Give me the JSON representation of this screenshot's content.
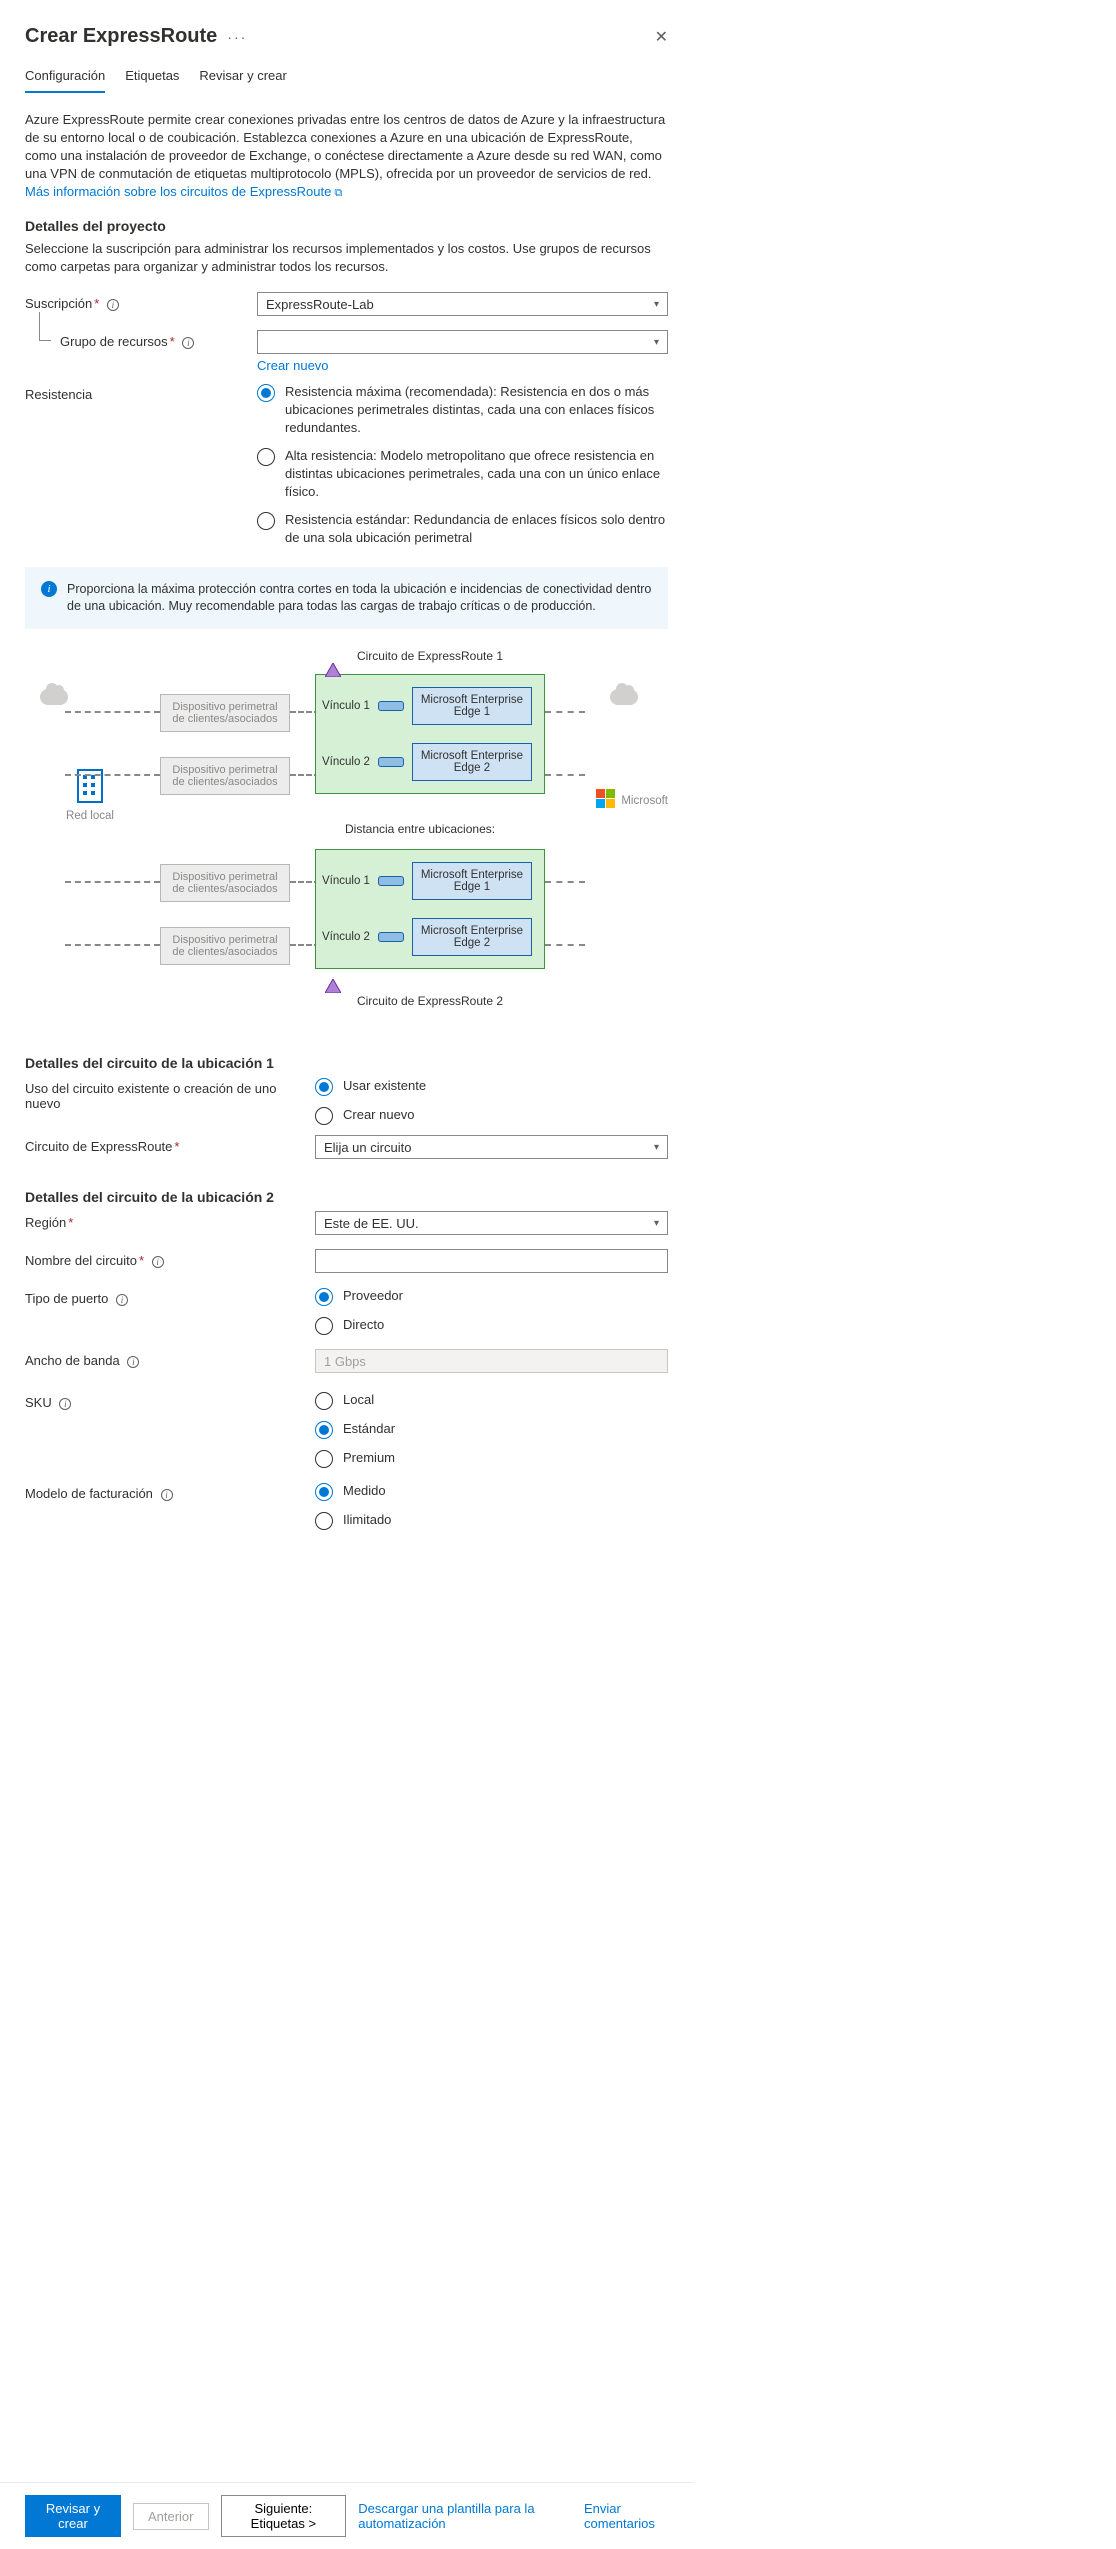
{
  "header": {
    "title": "Crear ExpressRoute",
    "more": "···",
    "close": "✕"
  },
  "tabs": [
    {
      "label": "Configuración",
      "active": true
    },
    {
      "label": "Etiquetas",
      "active": false
    },
    {
      "label": "Revisar y crear",
      "active": false
    }
  ],
  "intro": {
    "text": "Azure ExpressRoute permite crear conexiones privadas entre los centros de datos de Azure y la infraestructura de su entorno local o de coubicación. Establezca conexiones a Azure en una ubicación de ExpressRoute, como una instalación de proveedor de Exchange, o conéctese directamente a Azure desde su red WAN, como una VPN de conmutación de etiquetas multiprotocolo (MPLS), ofrecida por un proveedor de servicios de red. ",
    "link": "Más información sobre los circuitos de ExpressRoute"
  },
  "project": {
    "heading": "Detalles del proyecto",
    "desc": "Seleccione la suscripción para administrar los recursos implementados y los costos. Use grupos de recursos como carpetas para organizar y administrar todos los recursos.",
    "subscription_label": "Suscripción",
    "subscription_value": "ExpressRoute-Lab",
    "rg_label": "Grupo de recursos",
    "rg_value": "",
    "create_new": "Crear nuevo"
  },
  "resiliency": {
    "label": "Resistencia",
    "options": [
      "Resistencia máxima (recomendada): Resistencia en dos o más ubicaciones perimetrales distintas, cada una con enlaces físicos redundantes.",
      "Alta resistencia: Modelo metropolitano que ofrece resistencia en distintas ubicaciones perimetrales, cada una con un único enlace físico.",
      "Resistencia estándar: Redundancia de enlaces físicos solo dentro de una sola ubicación perimetral"
    ],
    "selected": 0,
    "info": "Proporciona la máxima protección contra cortes en toda la ubicación e incidencias de conectividad dentro de una ubicación. Muy recomendable para todas las cargas de trabajo críticas o de producción."
  },
  "diagram": {
    "circuit1": "Circuito de ExpressRoute 1",
    "circuit2": "Circuito de ExpressRoute 2",
    "link1": "Vínculo 1",
    "link2": "Vínculo 2",
    "mee1": "Microsoft Enterprise Edge 1",
    "mee2": "Microsoft Enterprise Edge 2",
    "edge": "Dispositivo perimetral de clientes/asociados",
    "onprem": "Red local",
    "ms": "Microsoft",
    "distance": "Distancia entre ubicaciones:"
  },
  "loc1": {
    "heading": "Detalles del circuito de la ubicación 1",
    "use_label": "Uso del circuito existente o creación de uno nuevo",
    "opt_existing": "Usar existente",
    "opt_new": "Crear nuevo",
    "circuit_label": "Circuito de ExpressRoute",
    "circuit_ph": "Elija un circuito"
  },
  "loc2": {
    "heading": "Detalles del circuito de la ubicación 2",
    "region_label": "Región",
    "region_value": "Este de EE. UU.",
    "name_label": "Nombre del circuito",
    "name_value": "",
    "port_label": "Tipo de puerto",
    "port_provider": "Proveedor",
    "port_direct": "Directo",
    "bw_label": "Ancho de banda",
    "bw_value": "1 Gbps",
    "sku_label": "SKU",
    "sku_local": "Local",
    "sku_standard": "Estándar",
    "sku_premium": "Premium",
    "billing_label": "Modelo de facturación",
    "billing_metered": "Medido",
    "billing_unlimited": "Ilimitado"
  },
  "footer": {
    "review": "Revisar y crear",
    "prev": "Anterior",
    "next": "Siguiente: Etiquetas >",
    "template": "Descargar una plantilla para la automatización",
    "feedback": "Enviar comentarios"
  }
}
